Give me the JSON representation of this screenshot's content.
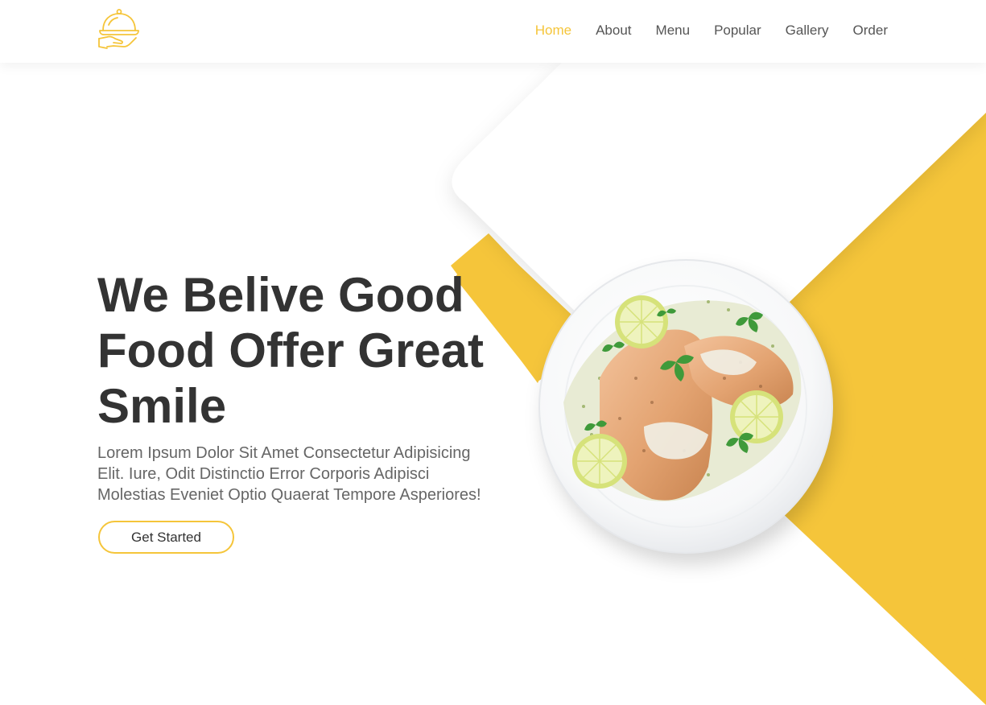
{
  "header": {
    "logo_icon": "serving-cloche-icon",
    "nav": [
      {
        "label": "Home",
        "active": true
      },
      {
        "label": "About",
        "active": false
      },
      {
        "label": "Menu",
        "active": false
      },
      {
        "label": "Popular",
        "active": false
      },
      {
        "label": "Gallery",
        "active": false
      },
      {
        "label": "Order",
        "active": false
      }
    ]
  },
  "hero": {
    "title": "We Belive Good Food Offer Great Smile",
    "text": "Lorem Ipsum Dolor Sit Amet Consectetur Adipisicing Elit. Iure, Odit Distinctio Error Corporis Adipisci Molestias Eveniet Optio Quaerat Tempore Asperiores!",
    "cta_label": "Get Started",
    "image": "grilled-chicken-plate-image"
  },
  "colors": {
    "accent": "#f5c53a",
    "heading": "#333333",
    "body_text": "#666666",
    "nav_text": "#555555"
  }
}
